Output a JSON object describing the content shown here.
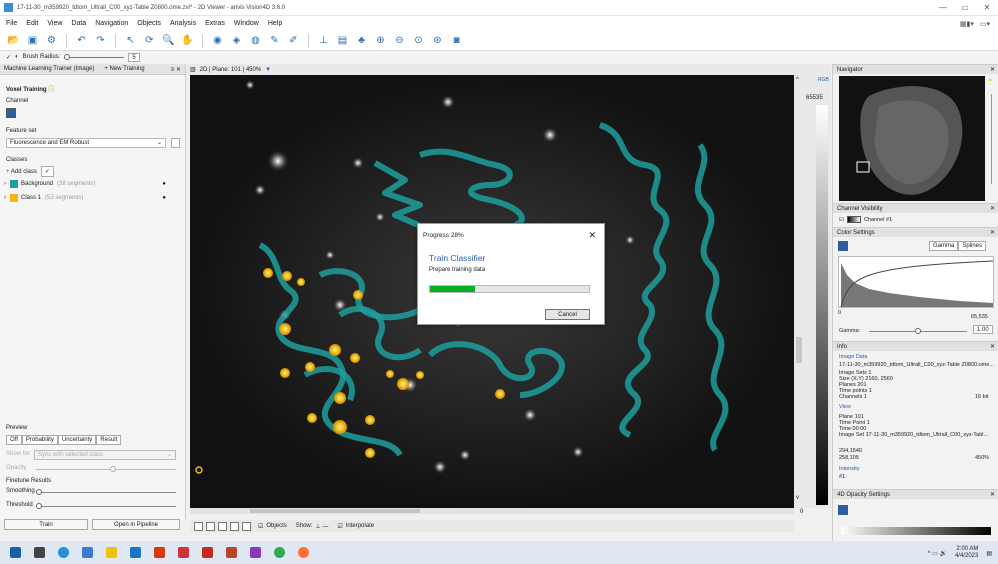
{
  "window": {
    "title": "17-11-30_m359920_tdtom_Ultrall_C00_xyz-Table Z0800.ome.zvi* - 2D Viewer - arivis Vision4D 3.6.0"
  },
  "menu": [
    "File",
    "Edit",
    "View",
    "Data",
    "Navigation",
    "Objects",
    "Analysis",
    "Extras",
    "Window",
    "Help"
  ],
  "brush": {
    "label": "Brush Radius:",
    "value": "5"
  },
  "left_panel": {
    "tab": "Machine Learning Trainer (Image)",
    "new_training": "+ New Training",
    "voxel_training": "Voxel Training",
    "channel_label": "Channel",
    "feature_set_label": "Feature set",
    "feature_set_value": "Fluorescence and EM Robust",
    "classes_label": "Classes",
    "add_class": "Add class",
    "classes": [
      {
        "name": "Background",
        "count": "(38 segments)",
        "color": "#1f9f9f"
      },
      {
        "name": "Class 1",
        "count": "(52 segments)",
        "color": "#f3b712"
      }
    ],
    "preview_label": "Preview",
    "preview_tabs": [
      "Off",
      "Probability",
      "Uncertainty",
      "Result"
    ],
    "show_for_label": "Show for",
    "show_for_value": "Sync with selected class",
    "opacity_label": "Opacity",
    "finetune_label": "Finetune Results",
    "smoothing_label": "Smoothing",
    "threshold_label": "Threshold",
    "train_btn": "Train",
    "open_pipeline_btn": "Open in Pipeline"
  },
  "viewer": {
    "header": "2D | Plane: 101 | 450%",
    "rgb_label": "RGB",
    "max_value": "65535",
    "min_value": "0",
    "objects_label": "Objects",
    "show_label": "Show:",
    "interpolate_label": "Interpolate"
  },
  "dialog": {
    "title": "Progress 28%",
    "heading": "Train Classifier",
    "subtitle": "Prepare training data",
    "progress": 0.28,
    "cancel": "Cancel"
  },
  "right_panel": {
    "navigator": "Navigator",
    "channel_visibility": "Channel Visibility",
    "channel_name": "Channel #1",
    "color_settings": "Color Settings",
    "gamma_tab": "Gamma",
    "splines_tab": "Splines",
    "hist_min": "0",
    "hist_max": "65,535",
    "gamma_label": "Gamma:",
    "gamma_value": "1.00",
    "info": "Info",
    "image_data": "Image Data",
    "file_name": "17-11-30_m359920_tdtom_Ultrall_C00_xyz-Table Z0800.ome...",
    "image_sets": "Image Sets   1",
    "size": "Size (X,Y)   2160, 2560",
    "planes": "Planes   201",
    "time_points": "Time points   1",
    "channels": "Channels   1",
    "bit_depth": "16 bit",
    "view": "View",
    "plane": "Plane   101",
    "time_point": "Time Point   1",
    "time": "Time   00:00",
    "image_set": "Image Set   17-11-30_m359920_tdtom_Ultrall_C00_xyz-Tabl...",
    "coord1": "294,1540",
    "coord2": "258,105",
    "zoom": "450%",
    "intensity": "Intensity",
    "intensity_val": "#1:",
    "opacity_settings": "4D Opacity Settings"
  },
  "taskbar": {
    "time": "2:00 AM",
    "date": "4/4/2023"
  },
  "colors": {
    "background_class": "#1f9f9f",
    "class1": "#f3b712",
    "progress": "#06b025",
    "accent": "#2a5db0"
  }
}
